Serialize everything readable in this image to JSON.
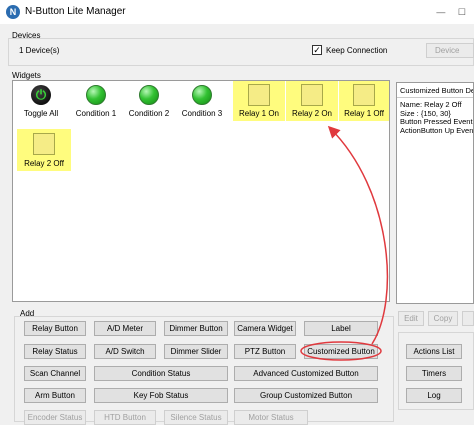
{
  "window": {
    "title": "N-Button Lite Manager",
    "icon": "N"
  },
  "devices": {
    "group_label": "Devices",
    "count_text": "1 Device(s)",
    "keep_connection_label": "Keep Connection",
    "keep_connection_checked": true,
    "devices_button_label": "Device"
  },
  "widgets": {
    "group_label": "Widgets",
    "items": [
      {
        "label": "Toggle All",
        "kind": "power"
      },
      {
        "label": "Condition 1",
        "kind": "led"
      },
      {
        "label": "Condition 2",
        "kind": "led"
      },
      {
        "label": "Condition 3",
        "kind": "led"
      },
      {
        "label": "Relay 1 On",
        "kind": "relay"
      },
      {
        "label": "Relay 2 On",
        "kind": "relay"
      },
      {
        "label": "Relay 1 Off",
        "kind": "relay"
      },
      {
        "label": "Relay 2 Off",
        "kind": "relay"
      }
    ]
  },
  "properties": {
    "title": "Customized Button De",
    "lines": [
      "Name: Relay 2 Off",
      "Size : {150, 30}",
      "Button Pressed Event",
      "ActionButton Up Even"
    ]
  },
  "add": {
    "group_label": "Add",
    "buttons": {
      "relay_button": "Relay Button",
      "ad_meter": "A/D Meter",
      "dimmer_button": "Dimmer Button",
      "camera_widget": "Camera Widget",
      "label": "Label",
      "relay_status": "Relay Status",
      "ad_switch": "A/D Switch",
      "dimmer_slider": "Dimmer Slider",
      "ptz_button": "PTZ Button",
      "customized_button": "Customized Button",
      "scan_channel": "Scan Channel",
      "condition_status": "Condition Status",
      "advanced_customized_button": "Advanced Customized Button",
      "arm_button": "Arm Button",
      "key_fob_status": "Key Fob Status",
      "group_customized_button": "Group Customized Button",
      "encoder_status": "Encoder Status",
      "htd_button": "HTD Button",
      "silence_status": "Silence Status",
      "motor_status": "Motor Status"
    }
  },
  "side_buttons": {
    "edit": "Edit",
    "copy": "Copy",
    "actions_list": "Actions List",
    "timers": "Timers",
    "log": "Log"
  },
  "colors": {
    "highlight": "#fffc7e",
    "annotation": "#e0393e",
    "led_green": "#33c233"
  }
}
